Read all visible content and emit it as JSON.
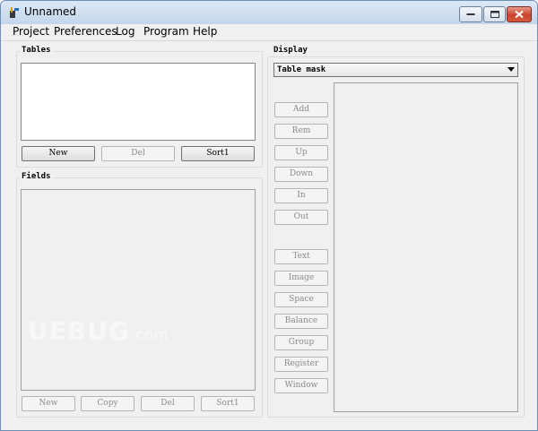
{
  "window": {
    "title": "Unnamed"
  },
  "menu": [
    "Project",
    "Preferences",
    "Log",
    "Program",
    "Help"
  ],
  "tables": {
    "label": "Tables",
    "buttons": [
      {
        "label": "New",
        "enabled": true
      },
      {
        "label": "Del",
        "enabled": false
      },
      {
        "label": "Sort1",
        "enabled": true
      }
    ]
  },
  "fields": {
    "label": "Fields",
    "buttons": [
      {
        "label": "New",
        "enabled": false
      },
      {
        "label": "Copy",
        "enabled": false
      },
      {
        "label": "Del",
        "enabled": false
      },
      {
        "label": "Sort1",
        "enabled": false
      }
    ]
  },
  "display": {
    "label": "Display",
    "selected": "Table mask",
    "buttons": [
      "Add",
      "Rem",
      "Up",
      "Down",
      "In",
      "Out",
      "Text",
      "Image",
      "Space",
      "Balance",
      "Group",
      "Register",
      "Window"
    ]
  },
  "watermark": {
    "main": "UEBUG",
    "suffix": ".com"
  }
}
